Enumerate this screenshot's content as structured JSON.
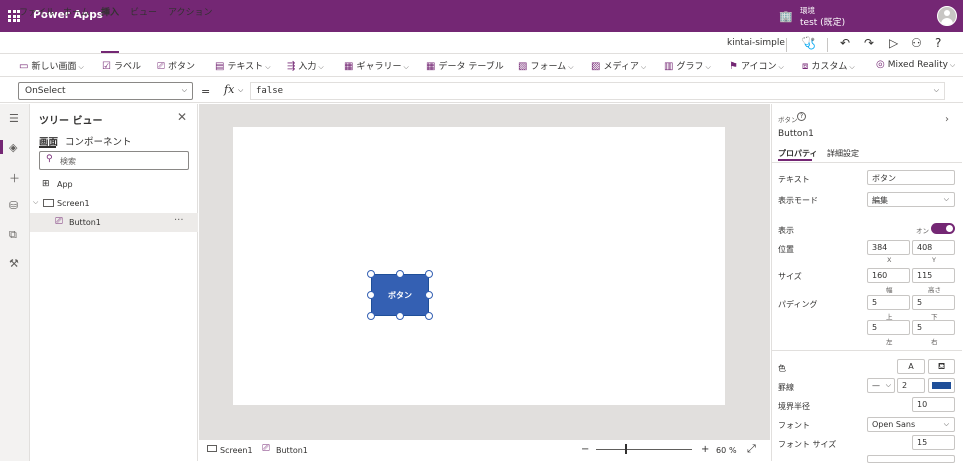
{
  "titlebar": {
    "app_name": "Power Apps",
    "env_label": "環境",
    "env_name": "test (既定)"
  },
  "menu": {
    "items": [
      "ファイル",
      "ホーム",
      "挿入",
      "ビュー",
      "アクション"
    ],
    "active": "挿入",
    "app_title": "kintai-simple"
  },
  "ribbon": {
    "items": [
      {
        "label": "新しい画面",
        "icon": "new-screen-icon",
        "chevron": true
      },
      {
        "label": "ラベル",
        "icon": "label-icon",
        "chevron": false
      },
      {
        "label": "ボタン",
        "icon": "button-icon",
        "chevron": false
      },
      {
        "label": "テキスト",
        "icon": "text-icon",
        "chevron": true
      },
      {
        "label": "入力",
        "icon": "input-icon",
        "chevron": true
      },
      {
        "label": "ギャラリー",
        "icon": "gallery-icon",
        "chevron": true
      },
      {
        "label": "データ テーブル",
        "icon": "data-table-icon",
        "chevron": false
      },
      {
        "label": "フォーム",
        "icon": "form-icon",
        "chevron": true
      },
      {
        "label": "メディア",
        "icon": "media-icon",
        "chevron": true
      },
      {
        "label": "グラフ",
        "icon": "chart-icon",
        "chevron": true
      },
      {
        "label": "アイコン",
        "icon": "icons-icon",
        "chevron": true
      },
      {
        "label": "カスタム",
        "icon": "custom-icon",
        "chevron": true
      },
      {
        "label": "Mixed Reality",
        "icon": "mixed-reality-icon",
        "chevron": true
      }
    ]
  },
  "formula": {
    "property": "OnSelect",
    "equals": "=",
    "fx": "fx",
    "value": "false"
  },
  "tree": {
    "title": "ツリー ビュー",
    "tabs": [
      "画面",
      "コンポーネント"
    ],
    "search_placeholder": "検索",
    "nodes": [
      {
        "label": "App",
        "icon": "app-icon"
      },
      {
        "label": "Screen1",
        "icon": "screen-icon"
      },
      {
        "label": "Button1",
        "icon": "button-icon"
      }
    ],
    "more": "···"
  },
  "canvas": {
    "button_text": "ボタン"
  },
  "status": {
    "screen": "Screen1",
    "control": "Button1",
    "zoom_minus": "−",
    "zoom_plus": "+",
    "zoom": "60",
    "zoom_unit": "%"
  },
  "props": {
    "type_label": "ボタン",
    "control_name": "Button1",
    "tabs": [
      "プロパティ",
      "詳細設定"
    ],
    "text_label": "テキスト",
    "text_value": "ボタン",
    "display_mode_label": "表示モード",
    "display_mode_value": "編集",
    "visible_label": "表示",
    "visible_value": "オン",
    "position_label": "位置",
    "x": "384",
    "y": "408",
    "x_label": "X",
    "y_label": "Y",
    "size_label": "サイズ",
    "width": "160",
    "height": "115",
    "width_label": "幅",
    "height_label": "高さ",
    "padding_label": "パディング",
    "pad_top": "5",
    "pad_bottom": "5",
    "pad_left": "5",
    "pad_right": "5",
    "pad_top_label": "上",
    "pad_bottom_label": "下",
    "pad_left_label": "左",
    "pad_right_label": "右",
    "color_label": "色",
    "color_a": "A",
    "border_label": "罫線",
    "border_width": "2",
    "border_color": "#1f4f99",
    "radius_label": "境界半径",
    "radius_value": "10",
    "font_label": "フォント",
    "font_value": "Open Sans",
    "font_size_label": "フォント サイズ",
    "font_size_value": "15"
  },
  "colors": {
    "brand": "#742774",
    "button_fill": "#3460b3"
  }
}
